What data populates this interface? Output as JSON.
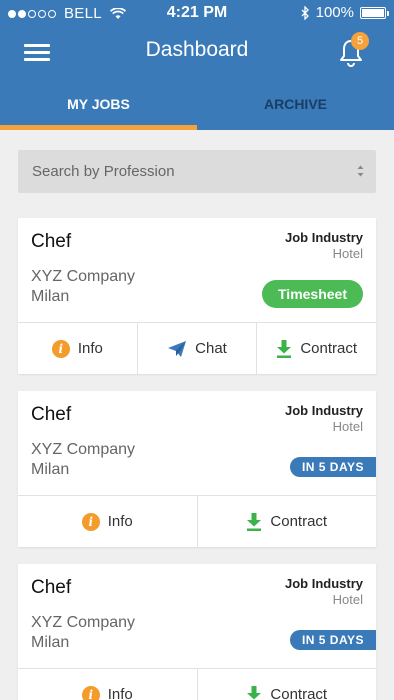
{
  "status": {
    "carrier": "BELL",
    "time": "4:21 PM",
    "battery": "100%"
  },
  "header": {
    "title": "Dashboard",
    "notification_count": "5"
  },
  "tabs": [
    {
      "label": "MY JOBS",
      "active": true
    },
    {
      "label": "ARCHIVE",
      "active": false
    }
  ],
  "search": {
    "placeholder": "Search by Profession"
  },
  "jobs": [
    {
      "title": "Chef",
      "company": "XYZ Company",
      "city": "Milan",
      "industry_label": "Job Industry",
      "industry_value": "Hotel",
      "badge": "Timesheet",
      "actions": [
        "Info",
        "Chat",
        "Contract"
      ]
    },
    {
      "title": "Chef",
      "company": "XYZ Company",
      "city": "Milan",
      "industry_label": "Job Industry",
      "industry_value": "Hotel",
      "badge": "IN 5 DAYS",
      "actions": [
        "Info",
        "Contract"
      ]
    },
    {
      "title": "Chef",
      "company": "XYZ Company",
      "city": "Milan",
      "industry_label": "Job Industry",
      "industry_value": "Hotel",
      "badge": "IN 5 DAYS",
      "actions": [
        "Info",
        "Contract"
      ]
    }
  ],
  "icons": {
    "menu": "hamburger-menu-icon",
    "notifications": "bell-icon",
    "info": "info-icon",
    "chat": "paper-plane-icon",
    "contract": "download-icon",
    "search_select": "select-arrows-icon"
  },
  "colors": {
    "header": "#3a7ab8",
    "tab_indicator": "#f4a23c",
    "badge_blue": "#3a7ab8",
    "timesheet_green": "#4cbb55",
    "info_orange": "#f39c2c",
    "contract_green": "#3cb34a"
  }
}
